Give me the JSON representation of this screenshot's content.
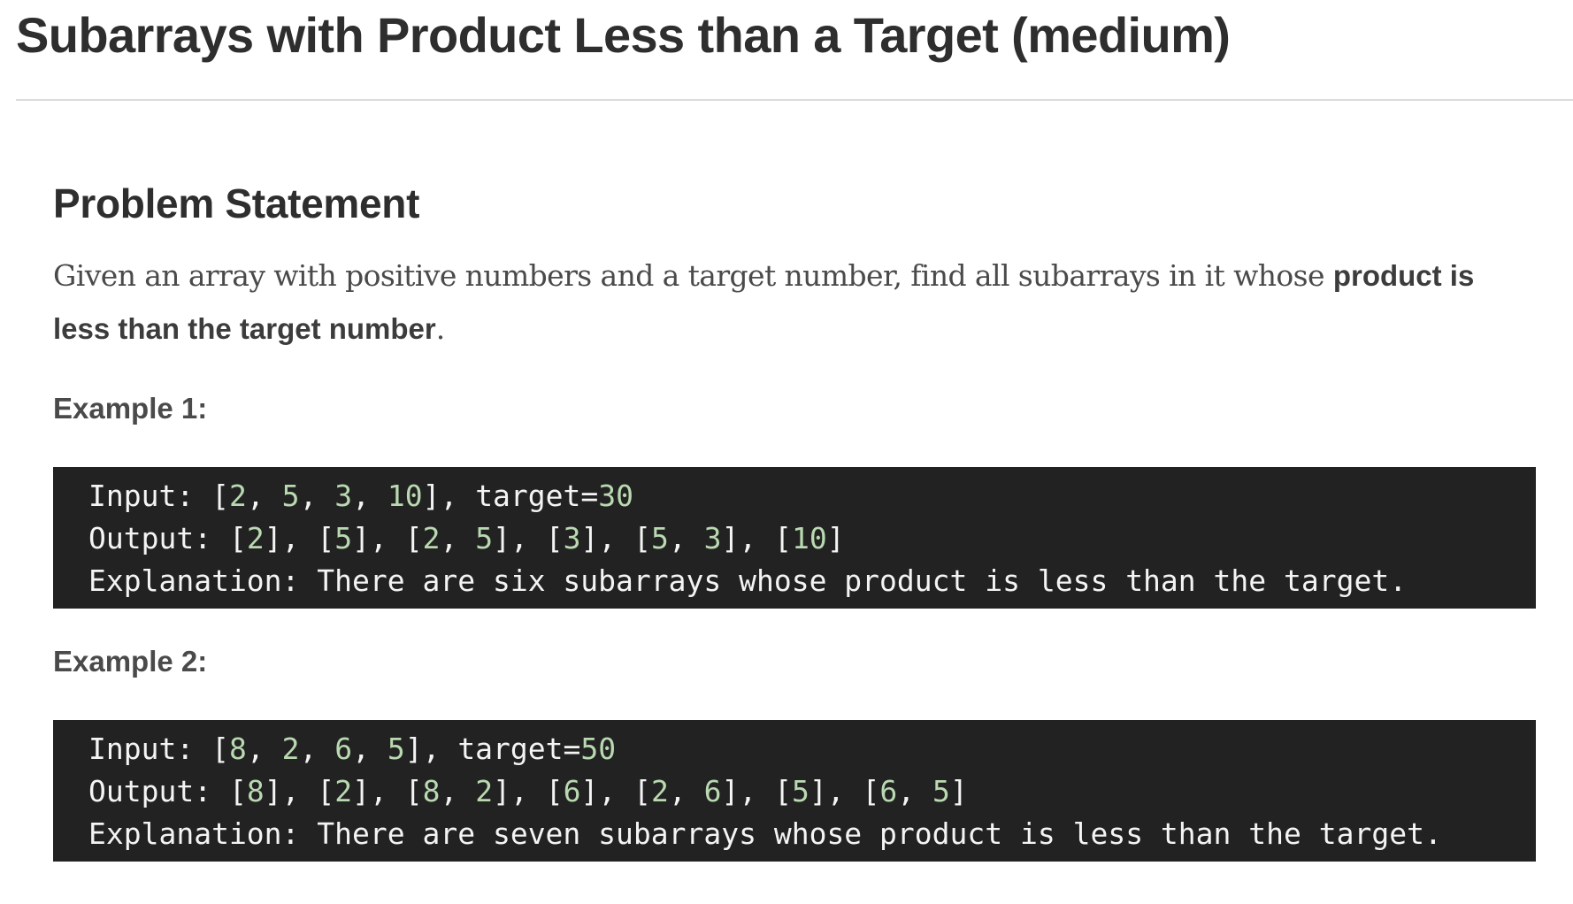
{
  "page": {
    "title": "Subarrays with Product Less than a Target (medium)"
  },
  "problem": {
    "heading": "Problem Statement",
    "statement_text": "Given an array with positive numbers and a target number, find all subarrays in it whose ",
    "statement_bold": "product is less than the target number",
    "statement_end": "."
  },
  "examples": [
    {
      "label": "Example 1:",
      "input_label": "Input:",
      "input_array": [
        2,
        5,
        3,
        10
      ],
      "target_label": "target=",
      "target": 30,
      "output_label": "Output:",
      "output": [
        [
          2
        ],
        [
          5
        ],
        [
          2,
          5
        ],
        [
          3
        ],
        [
          5,
          3
        ],
        [
          10
        ]
      ],
      "explanation_label": "Explanation:",
      "explanation": "There are six subarrays whose product is less than the target."
    },
    {
      "label": "Example 2:",
      "input_label": "Input:",
      "input_array": [
        8,
        2,
        6,
        5
      ],
      "target_label": "target=",
      "target": 50,
      "output_label": "Output:",
      "output": [
        [
          8
        ],
        [
          2
        ],
        [
          8,
          2
        ],
        [
          6
        ],
        [
          2,
          6
        ],
        [
          5
        ],
        [
          6,
          5
        ]
      ],
      "explanation_label": "Explanation:",
      "explanation": "There are seven subarrays whose product is less than the target."
    }
  ],
  "colors": {
    "code_background": "#222222",
    "code_text": "#f4f4f4",
    "code_number": "#b9d9b1",
    "title_text": "#2e2e2e",
    "body_text": "#4a4a4a",
    "rule": "#dcdcdc"
  }
}
